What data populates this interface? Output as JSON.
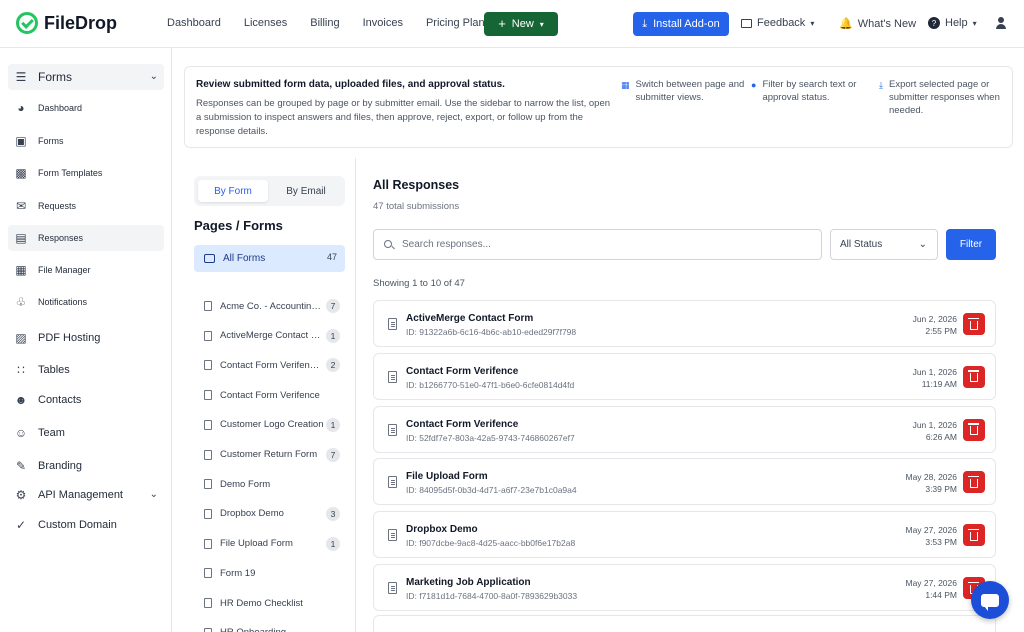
{
  "app": {
    "name": "FileDrop"
  },
  "topnav": {
    "links": [
      "Dashboard",
      "Licenses",
      "Billing",
      "Invoices",
      "Pricing Plans"
    ],
    "new_label": "New",
    "install_label": "Install Add-on",
    "feedback_label": "Feedback",
    "whats_new_label": "What's New",
    "help_label": "Help"
  },
  "sidebar": {
    "items": [
      {
        "label": "Forms",
        "icon": "layers-icon",
        "style": "group",
        "chevron": true
      },
      {
        "label": "Dashboard",
        "icon": "pie-chart-icon",
        "style": "small"
      },
      {
        "label": "Forms",
        "icon": "briefcase-icon",
        "style": "small"
      },
      {
        "label": "Form Templates",
        "icon": "clipboard-icon",
        "style": "small"
      },
      {
        "label": "Requests",
        "icon": "envelope-icon",
        "style": "small"
      },
      {
        "label": "Responses",
        "icon": "message-icon",
        "style": "small",
        "active": true
      },
      {
        "label": "File Manager",
        "icon": "grid-icon",
        "style": "small"
      },
      {
        "label": "Notifications",
        "icon": "bell-icon",
        "style": "small"
      },
      {
        "label": "PDF Hosting",
        "icon": "pdf-icon",
        "style": "big"
      },
      {
        "label": "Tables",
        "icon": "dots-grid-icon",
        "style": "big"
      },
      {
        "label": "Contacts",
        "icon": "users-icon",
        "style": "big"
      },
      {
        "label": "Team",
        "icon": "team-icon",
        "style": "big"
      },
      {
        "label": "Branding",
        "icon": "brush-icon",
        "style": "big"
      },
      {
        "label": "API Management",
        "icon": "gear-icon",
        "style": "big",
        "chevron": true
      },
      {
        "label": "Custom Domain",
        "icon": "badge-check-icon",
        "style": "big"
      }
    ]
  },
  "banner": {
    "title": "Review submitted form data, uploaded files, and approval status.",
    "text": "Responses can be grouped by page or by submitter email. Use the sidebar to narrow the list, open a submission to inspect answers and files, then approve, reject, export, or follow up from the response details.",
    "tips": [
      "Switch between page and submitter views.",
      "Filter by search text or approval status.",
      "Export selected page or submitter responses when needed."
    ]
  },
  "toggle": {
    "by_form": "By Form",
    "by_email": "By Email"
  },
  "pages": {
    "title": "Pages / Forms",
    "all_label": "All Forms",
    "all_count": "47",
    "items": [
      {
        "label": "Acme Co. - Accounting Intake",
        "count": "7"
      },
      {
        "label": "ActiveMerge Contact Form",
        "count": "1"
      },
      {
        "label": "Contact Form Verifence Copy",
        "count": "2"
      },
      {
        "label": "Contact Form Verifence",
        "count": ""
      },
      {
        "label": "Customer Logo Creation",
        "count": "1"
      },
      {
        "label": "Customer Return Form",
        "count": "7"
      },
      {
        "label": "Demo Form",
        "count": ""
      },
      {
        "label": "Dropbox Demo",
        "count": "3"
      },
      {
        "label": "File Upload Form",
        "count": "1"
      },
      {
        "label": "Form 19",
        "count": ""
      },
      {
        "label": "HR Demo Checklist",
        "count": ""
      },
      {
        "label": "HR Onboarding",
        "count": ""
      }
    ]
  },
  "main": {
    "title": "All Responses",
    "subtitle": "47 total submissions",
    "search_placeholder": "Search responses...",
    "status_value": "All Status",
    "filter_label": "Filter",
    "showing": "Showing 1 to 10 of 47",
    "responses": [
      {
        "title": "ActiveMerge Contact Form",
        "id": "ID: 91322a6b-6c16-4b6c-ab10-eded29f7f798",
        "date": "Jun 2, 2026",
        "time": "2:55 PM"
      },
      {
        "title": "Contact Form Verifence",
        "id": "ID: b1266770-51e0-47f1-b6e0-6cfe0814d4fd",
        "date": "Jun 1, 2026",
        "time": "11:19 AM"
      },
      {
        "title": "Contact Form Verifence",
        "id": "ID: 52fdf7e7-803a-42a5-9743-746860267ef7",
        "date": "Jun 1, 2026",
        "time": "6:26 AM"
      },
      {
        "title": "File Upload Form",
        "id": "ID: 84095d5f-0b3d-4d71-a6f7-23e7b1c0a9a4",
        "date": "May 28, 2026",
        "time": "3:39 PM"
      },
      {
        "title": "Dropbox Demo",
        "id": "ID: f907dcbe-9ac8-4d25-aacc-bb0f6e17b2a8",
        "date": "May 27, 2026",
        "time": "3:53 PM"
      },
      {
        "title": "Marketing Job Application",
        "id": "ID: f7181d1d-7684-4700-8a0f-7893629b3033",
        "date": "May 27, 2026",
        "time": "1:44 PM"
      }
    ]
  }
}
